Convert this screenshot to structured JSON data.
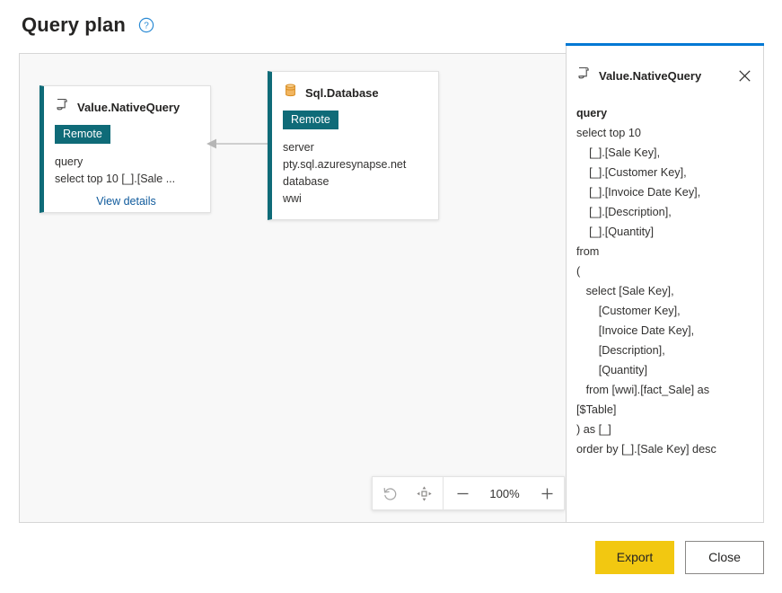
{
  "header": {
    "title": "Query plan",
    "help_icon": "help-circle-icon"
  },
  "canvas": {
    "nodes": [
      {
        "id": "value-native-query",
        "icon": "query-scroll-icon",
        "title": "Value.NativeQuery",
        "badge": "Remote",
        "rows": [
          "query",
          "select top 10 [_].[Sale ..."
        ],
        "link": "View details"
      },
      {
        "id": "sql-database",
        "icon": "database-cylinder-icon",
        "title": "Sql.Database",
        "badge": "Remote",
        "rows": [
          "server",
          "pty.sql.azuresynapse.net",
          "database",
          "wwi"
        ]
      }
    ],
    "edge": {
      "from": "sql-database",
      "to": "value-native-query",
      "direction": "left"
    }
  },
  "zoom_toolbar": {
    "reset_icon": "undo-arrow-icon",
    "fit_icon": "fit-to-view-icon",
    "zoom_out_icon": "minus-icon",
    "zoom_in_icon": "plus-icon",
    "level": "100%"
  },
  "side_panel": {
    "icon": "query-scroll-icon",
    "title": "Value.NativeQuery",
    "close_icon": "close-x-icon",
    "field_label": "query",
    "query_text": "select top 10\n    [_].[Sale Key],\n    [_].[Customer Key],\n    [_].[Invoice Date Key],\n    [_].[Description],\n    [_].[Quantity]\nfrom\n(\n   select [Sale Key],\n       [Customer Key],\n       [Invoice Date Key],\n       [Description],\n       [Quantity]\n   from [wwi].[fact_Sale] as\n[$Table]\n) as [_]\norder by [_].[Sale Key] desc"
  },
  "footer": {
    "export_label": "Export",
    "close_label": "Close"
  },
  "colors": {
    "accent_blue": "#0078d4",
    "node_accent_teal": "#0f6b78",
    "badge_teal": "#0f6b78",
    "export_yellow": "#f2c811",
    "link_blue": "#0f5a9c",
    "db_icon_orange": "#e8a33d",
    "canvas_bg": "#f8f8f8"
  }
}
